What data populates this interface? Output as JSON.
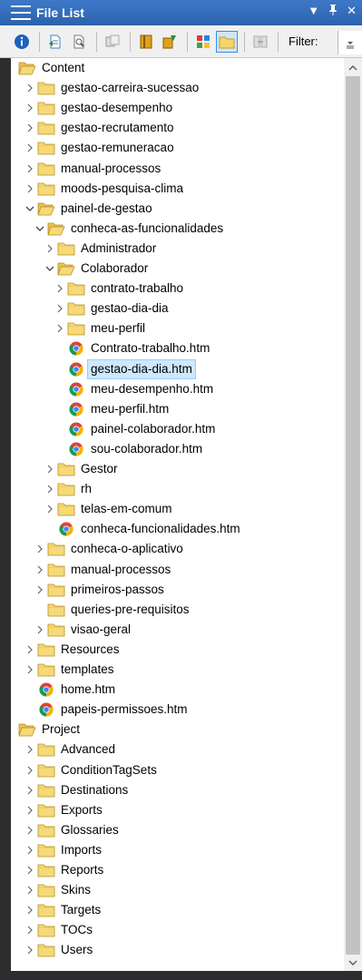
{
  "window": {
    "title": "File List",
    "pin_glyph": "▕",
    "close_glyph": "✕",
    "dropdown_glyph": "▼"
  },
  "toolbar": {
    "filter_label": "Filter:",
    "buttons": [
      "info-icon",
      "open-file-icon",
      "preview-icon",
      "copy-icon",
      "book-icon",
      "import-icon",
      "view-grid-icon",
      "folder-view-icon",
      "compare-icon"
    ]
  },
  "colors": {
    "titlebar": "#2c62ad",
    "selection": "#cde8ff",
    "folder": "#f5d56a"
  },
  "tree": [
    {
      "label": "Content",
      "level": 0,
      "type": "folder-open",
      "arrow": "none"
    },
    {
      "label": "gestao-carreira-sucessao",
      "level": 1,
      "type": "folder",
      "arrow": "collapsed"
    },
    {
      "label": "gestao-desempenho",
      "level": 1,
      "type": "folder",
      "arrow": "collapsed"
    },
    {
      "label": "gestao-recrutamento",
      "level": 1,
      "type": "folder",
      "arrow": "collapsed"
    },
    {
      "label": "gestao-remuneracao",
      "level": 1,
      "type": "folder",
      "arrow": "collapsed"
    },
    {
      "label": "manual-processos",
      "level": 1,
      "type": "folder",
      "arrow": "collapsed"
    },
    {
      "label": "moods-pesquisa-clima",
      "level": 1,
      "type": "folder",
      "arrow": "collapsed"
    },
    {
      "label": "painel-de-gestao",
      "level": 1,
      "type": "folder-open",
      "arrow": "expanded"
    },
    {
      "label": "conheca-as-funcionalidades",
      "level": 2,
      "type": "folder-open",
      "arrow": "expanded"
    },
    {
      "label": "Administrador",
      "level": 3,
      "type": "folder",
      "arrow": "collapsed"
    },
    {
      "label": "Colaborador",
      "level": 3,
      "type": "folder-open",
      "arrow": "expanded"
    },
    {
      "label": "contrato-trabalho",
      "level": 4,
      "type": "folder",
      "arrow": "collapsed"
    },
    {
      "label": "gestao-dia-dia",
      "level": 4,
      "type": "folder",
      "arrow": "collapsed"
    },
    {
      "label": "meu-perfil",
      "level": 4,
      "type": "folder",
      "arrow": "collapsed"
    },
    {
      "label": "Contrato-trabalho.htm",
      "level": 4,
      "type": "htm",
      "arrow": "none"
    },
    {
      "label": "gestao-dia-dia.htm",
      "level": 4,
      "type": "htm",
      "arrow": "none",
      "selected": true
    },
    {
      "label": "meu-desempenho.htm",
      "level": 4,
      "type": "htm",
      "arrow": "none"
    },
    {
      "label": "meu-perfil.htm",
      "level": 4,
      "type": "htm",
      "arrow": "none"
    },
    {
      "label": "painel-colaborador.htm",
      "level": 4,
      "type": "htm",
      "arrow": "none"
    },
    {
      "label": "sou-colaborador.htm",
      "level": 4,
      "type": "htm",
      "arrow": "none"
    },
    {
      "label": "Gestor",
      "level": 3,
      "type": "folder",
      "arrow": "collapsed"
    },
    {
      "label": "rh",
      "level": 3,
      "type": "folder",
      "arrow": "collapsed"
    },
    {
      "label": "telas-em-comum",
      "level": 3,
      "type": "folder",
      "arrow": "collapsed"
    },
    {
      "label": "conheca-funcionalidades.htm",
      "level": 3,
      "type": "htm",
      "arrow": "none"
    },
    {
      "label": "conheca-o-aplicativo",
      "level": 2,
      "type": "folder",
      "arrow": "collapsed"
    },
    {
      "label": "manual-processos",
      "level": 2,
      "type": "folder",
      "arrow": "collapsed"
    },
    {
      "label": "primeiros-passos",
      "level": 2,
      "type": "folder",
      "arrow": "collapsed"
    },
    {
      "label": "queries-pre-requisitos",
      "level": 2,
      "type": "folder",
      "arrow": "none"
    },
    {
      "label": "visao-geral",
      "level": 2,
      "type": "folder",
      "arrow": "collapsed"
    },
    {
      "label": "Resources",
      "level": 1,
      "type": "folder",
      "arrow": "collapsed"
    },
    {
      "label": "templates",
      "level": 1,
      "type": "folder",
      "arrow": "collapsed"
    },
    {
      "label": "home.htm",
      "level": 1,
      "type": "htm",
      "arrow": "none"
    },
    {
      "label": "papeis-permissoes.htm",
      "level": 1,
      "type": "htm",
      "arrow": "none"
    },
    {
      "label": "Project",
      "level": 0,
      "type": "folder-open",
      "arrow": "none"
    },
    {
      "label": "Advanced",
      "level": 1,
      "type": "folder",
      "arrow": "collapsed"
    },
    {
      "label": "ConditionTagSets",
      "level": 1,
      "type": "folder",
      "arrow": "collapsed"
    },
    {
      "label": "Destinations",
      "level": 1,
      "type": "folder",
      "arrow": "collapsed"
    },
    {
      "label": "Exports",
      "level": 1,
      "type": "folder",
      "arrow": "collapsed"
    },
    {
      "label": "Glossaries",
      "level": 1,
      "type": "folder",
      "arrow": "collapsed"
    },
    {
      "label": "Imports",
      "level": 1,
      "type": "folder",
      "arrow": "collapsed"
    },
    {
      "label": "Reports",
      "level": 1,
      "type": "folder",
      "arrow": "collapsed"
    },
    {
      "label": "Skins",
      "level": 1,
      "type": "folder",
      "arrow": "collapsed"
    },
    {
      "label": "Targets",
      "level": 1,
      "type": "folder",
      "arrow": "collapsed"
    },
    {
      "label": "TOCs",
      "level": 1,
      "type": "folder",
      "arrow": "collapsed"
    },
    {
      "label": "Users",
      "level": 1,
      "type": "folder",
      "arrow": "collapsed"
    }
  ]
}
